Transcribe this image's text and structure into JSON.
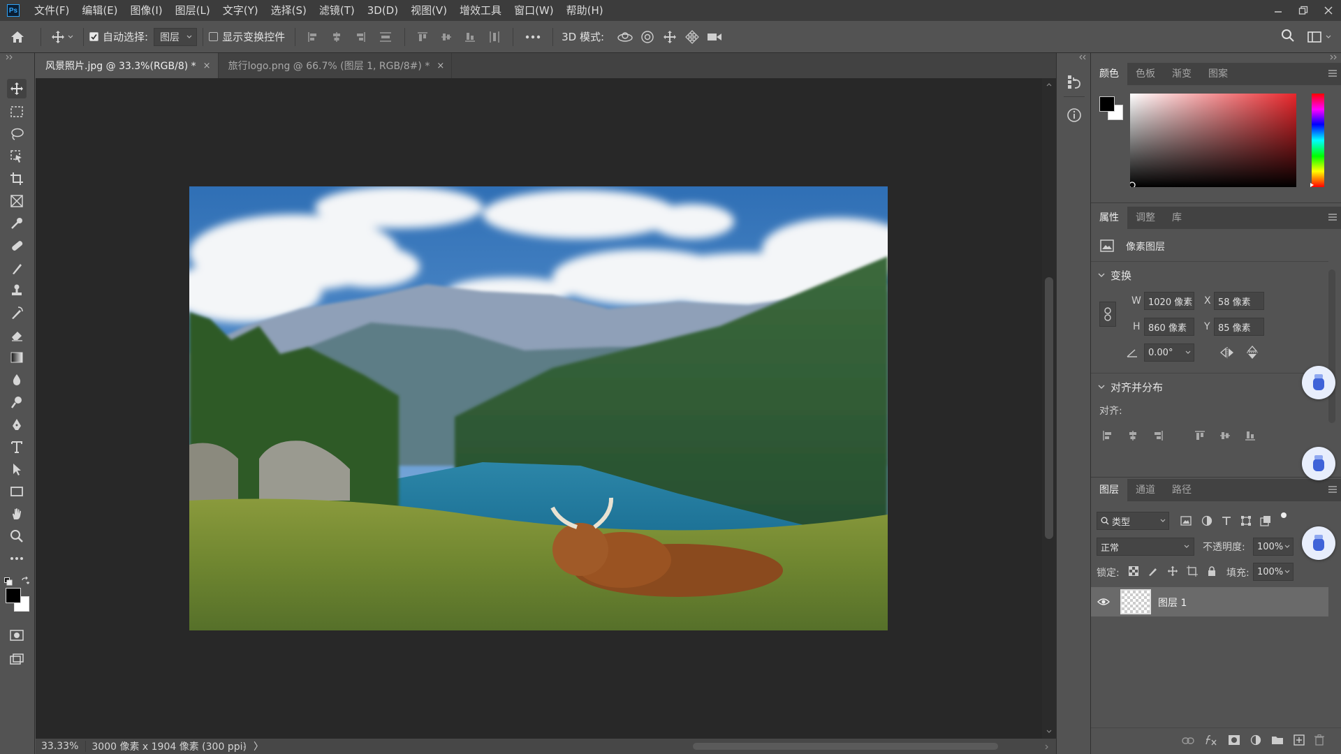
{
  "menubar": {
    "logo": "Ps",
    "items": [
      "文件(F)",
      "编辑(E)",
      "图像(I)",
      "图层(L)",
      "文字(Y)",
      "选择(S)",
      "滤镜(T)",
      "3D(D)",
      "视图(V)",
      "增效工具",
      "窗口(W)",
      "帮助(H)"
    ]
  },
  "options": {
    "auto_select_label": "自动选择:",
    "auto_select_value": "图层",
    "show_transform_label": "显示变换控件",
    "mode3d_label": "3D 模式:"
  },
  "tabs": [
    {
      "label": "风景照片.jpg @ 33.3%(RGB/8) *",
      "close": "×"
    },
    {
      "label": "旅行logo.png @ 66.7% (图层 1, RGB/8#) *",
      "close": "×"
    }
  ],
  "status": {
    "zoom": "33.33%",
    "doc_size": "3000 像素 x 1904 像素 (300 ppi)",
    "arrow": "〉"
  },
  "color_panel": {
    "tabs": [
      "颜色",
      "色板",
      "渐变",
      "图案"
    ],
    "foreground": "#000000",
    "background": "#ffffff",
    "hue": "#e8262b"
  },
  "properties_panel": {
    "tabs": [
      "属性",
      "调整",
      "库"
    ],
    "layer_type": "像素图层",
    "transform_title": "变换",
    "w_label": "W",
    "w_value": "1020 像素",
    "x_label": "X",
    "x_value": "58 像素",
    "h_label": "H",
    "h_value": "860 像素",
    "y_label": "Y",
    "y_value": "85 像素",
    "angle_value": "0.00°",
    "align_title": "对齐并分布",
    "align_label": "对齐:"
  },
  "layers_panel": {
    "tabs": [
      "图层",
      "通道",
      "路径"
    ],
    "filter_value": "类型",
    "blend_mode": "正常",
    "opacity_label": "不透明度:",
    "opacity_value": "100%",
    "lock_label": "锁定:",
    "fill_label": "填充:",
    "fill_value": "100%",
    "layers": [
      {
        "name": "图层 1"
      }
    ]
  }
}
